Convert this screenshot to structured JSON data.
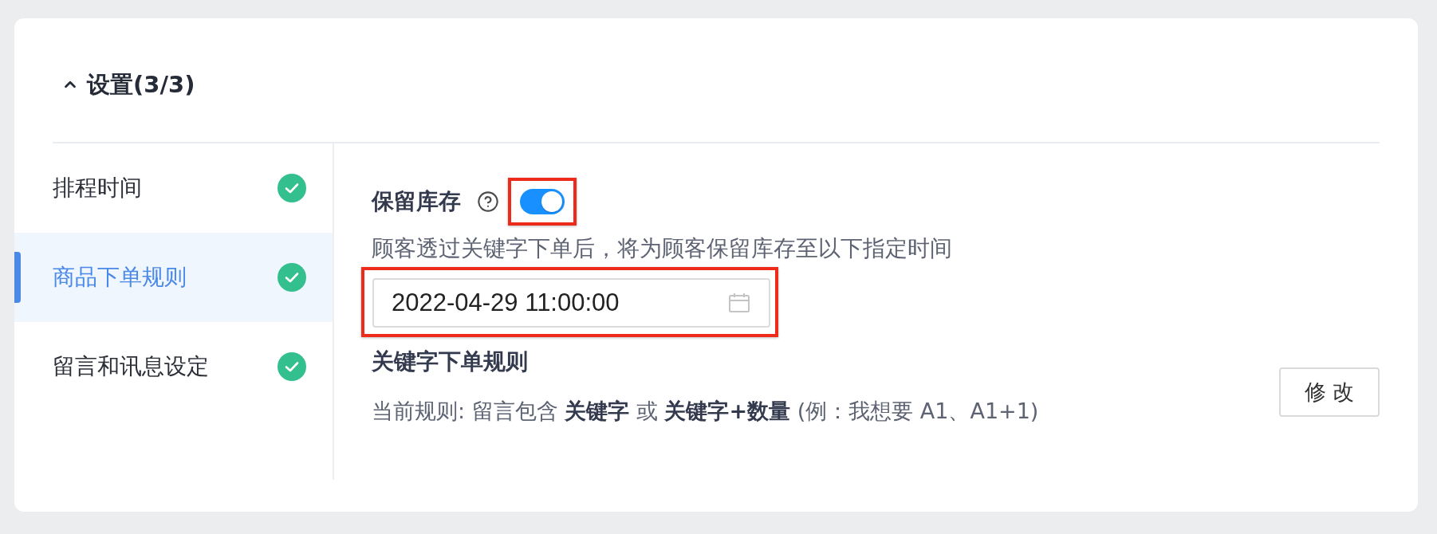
{
  "section": {
    "title": "设置(3/3)",
    "expanded": true
  },
  "sidebar": {
    "items": [
      {
        "label": "排程时间",
        "selected": false,
        "done": true
      },
      {
        "label": "商品下单规则",
        "selected": true,
        "done": true
      },
      {
        "label": "留言和讯息设定",
        "selected": false,
        "done": true
      }
    ]
  },
  "reserve_stock": {
    "label": "保留库存",
    "on": true,
    "highlighted": true,
    "description": "顾客透过关键字下单后，将为顾客保留库存至以下指定时间",
    "date_field": {
      "value": "2022-04-29 11:00:00",
      "highlighted": true
    }
  },
  "order_rule": {
    "title": "关键字下单规则",
    "text": "当前规则: 留言包含 **关键字** 或 **关键字+数量** (例：我想要 A1、A1+1)",
    "button": "修 改"
  }
}
